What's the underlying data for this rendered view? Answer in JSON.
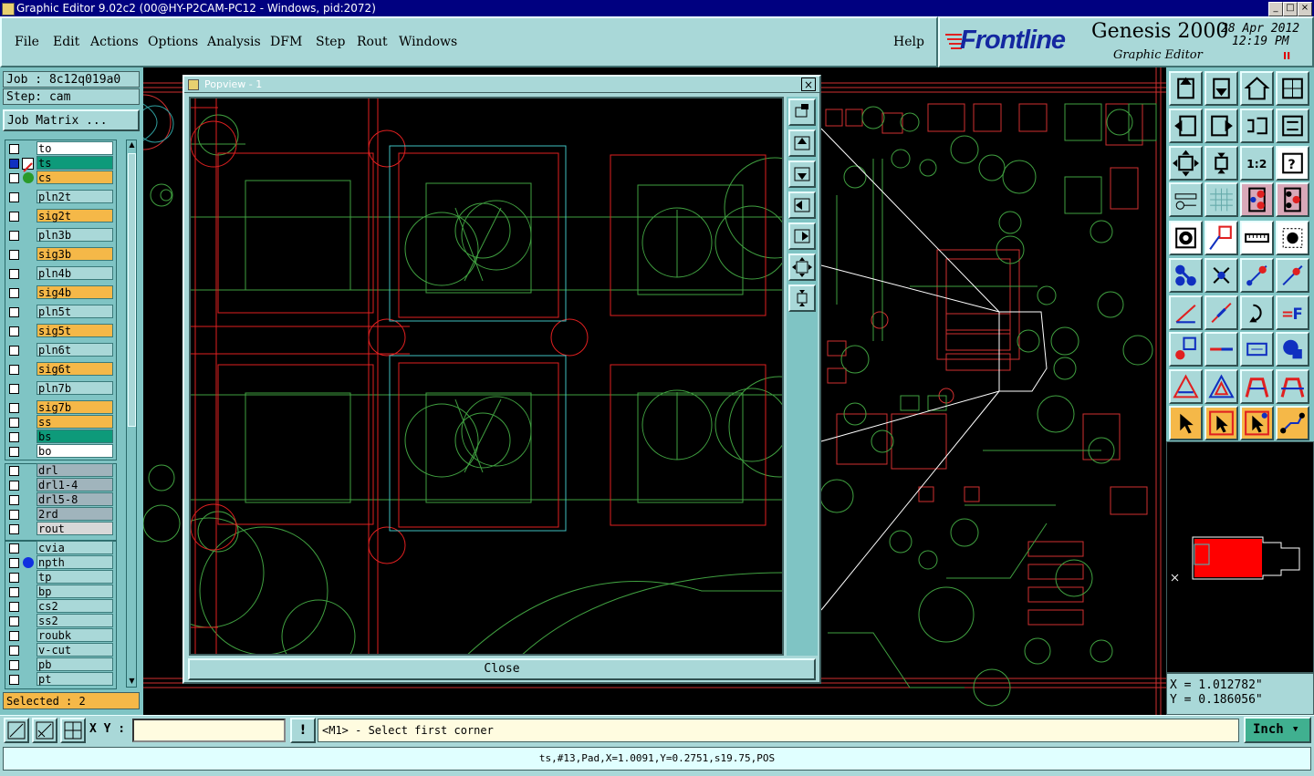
{
  "window": {
    "title": "Graphic Editor 9.02c2 (00@HY-P2CAM-PC12 - Windows, pid:2072)",
    "minimize": "_",
    "maximize": "□",
    "close": "×"
  },
  "menu": {
    "items": [
      "File",
      "Edit",
      "Actions",
      "Options",
      "Analysis",
      "DFM",
      "Step",
      "Rout",
      "Windows"
    ],
    "help": "Help"
  },
  "brand": {
    "logo": "Frontline",
    "product": "Genesis 2000",
    "subtitle": "Graphic Editor",
    "date": "28 Apr 2012",
    "time": "12:19 PM",
    "pause": "II"
  },
  "job": {
    "job_label": "Job : 8c12q019a0",
    "step_label": "Step: cam",
    "matrix_button": "Job Matrix ..."
  },
  "layers": [
    {
      "name": "to",
      "bg": "#ffffff"
    },
    {
      "name": "ts",
      "bg": "#0e9a7a"
    },
    {
      "name": "cs",
      "bg": "#f5b848"
    },
    {
      "name": "pln2t",
      "bg": "#a9d8d8"
    },
    {
      "name": "sig2t",
      "bg": "#f5b848"
    },
    {
      "name": "pln3b",
      "bg": "#a9d8d8"
    },
    {
      "name": "sig3b",
      "bg": "#f5b848"
    },
    {
      "name": "pln4b",
      "bg": "#a9d8d8"
    },
    {
      "name": "sig4b",
      "bg": "#f5b848"
    },
    {
      "name": "pln5t",
      "bg": "#a9d8d8"
    },
    {
      "name": "sig5t",
      "bg": "#f5b848"
    },
    {
      "name": "pln6t",
      "bg": "#a9d8d8"
    },
    {
      "name": "sig6t",
      "bg": "#f5b848"
    },
    {
      "name": "pln7b",
      "bg": "#a9d8d8"
    },
    {
      "name": "sig7b",
      "bg": "#f5b848"
    },
    {
      "name": "ss",
      "bg": "#f5b848"
    },
    {
      "name": "bs",
      "bg": "#0e9a7a"
    },
    {
      "name": "bo",
      "bg": "#ffffff"
    },
    {
      "name": "drl",
      "bg": "#a0b4bc"
    },
    {
      "name": "drl1-4",
      "bg": "#a0b4bc"
    },
    {
      "name": "drl5-8",
      "bg": "#a0b4bc"
    },
    {
      "name": "2rd",
      "bg": "#a0b4bc"
    },
    {
      "name": "rout",
      "bg": "#d8d8d8"
    },
    {
      "name": "cvia",
      "bg": "#a9d8d8"
    },
    {
      "name": "npth",
      "bg": "#a9d8d8"
    },
    {
      "name": "tp",
      "bg": "#a9d8d8"
    },
    {
      "name": "bp",
      "bg": "#a9d8d8"
    },
    {
      "name": "cs2",
      "bg": "#a9d8d8"
    },
    {
      "name": "ss2",
      "bg": "#a9d8d8"
    },
    {
      "name": "roubk",
      "bg": "#a9d8d8"
    },
    {
      "name": "v-cut",
      "bg": "#a9d8d8"
    },
    {
      "name": "pb",
      "bg": "#a9d8d8"
    },
    {
      "name": "pt",
      "bg": "#a9d8d8"
    }
  ],
  "selected_label": "Selected : 2",
  "popview": {
    "title": "Popview - 1",
    "close_x": "×",
    "close_button": "Close"
  },
  "coords": {
    "x": "X = 1.012782\"",
    "y": "Y = 0.186056\""
  },
  "command": {
    "xy_label": "X Y :",
    "xy_value": "",
    "alert": "!",
    "prompt": "<M1> - Select first corner",
    "units": "Inch"
  },
  "status": "ts,#13,Pad,X=1.0091,Y=0.2751,s19.75,POS",
  "tool_icons": [
    "zoom-home-icon",
    "zoom-back-icon",
    "home-view-icon",
    "split-view-icon",
    "pan-left-icon",
    "pan-right-icon",
    "pan-center-icon",
    "redraw-icon",
    "fit-all-icon",
    "fit-profile-icon",
    "zoom-1-2-icon",
    "query-icon",
    "measure-tool-icon",
    "grid-icon",
    "snap-red-icon",
    "snap-layers-icon",
    "pad-add-icon",
    "line-add-icon",
    "ruler-icon",
    "dot-icon",
    "node-icon",
    "cross-icon",
    "arc-add-icon",
    "line-diag-icon",
    "angle-icon",
    "slash-icon",
    "rotate-icon",
    "text-f-icon",
    "move-pad-icon",
    "cut-icon",
    "dimension-icon",
    "blob-icon",
    "triangle-edit-icon",
    "triangle-icon",
    "arch-icon",
    "arch-cut-icon",
    "select-arrow-icon",
    "select-box-icon",
    "select-pin-icon",
    "route-select-icon"
  ],
  "bottom_icons": [
    "zoom-area-icon",
    "measure-icon",
    "grid-snap-icon"
  ]
}
